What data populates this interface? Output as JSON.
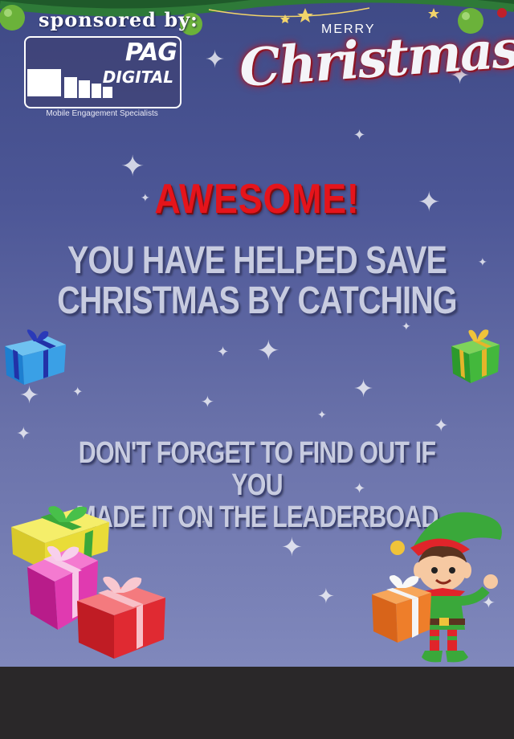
{
  "sponsor": {
    "label": "sponsored by:",
    "logo_word1": "PAG",
    "logo_word2": "DIGITAL",
    "tagline": "Mobile Engagement Specialists"
  },
  "banner": {
    "merry": "MERRY",
    "christmas": "Christmas"
  },
  "result": {
    "title": "AWESOME!",
    "message_line1": "YOU HAVE HELPED SAVE",
    "message_line2": "CHRISTMAS BY CATCHING",
    "reminder_line1": "DON'T FORGET TO FIND OUT IF YOU",
    "reminder_line2": "MADE IT ON THE LEADERBOAD"
  },
  "colors": {
    "title_red": "#e5141b",
    "text_silver": "#c8cce0",
    "background_top": "#3f4a86",
    "background_bottom": "#8088bc",
    "bottom_bar": "#2a2829"
  },
  "icons": [
    "garland-icon",
    "ornament-icon",
    "gift-icon",
    "elf-icon",
    "sparkle-icon",
    "monitor-icon"
  ]
}
